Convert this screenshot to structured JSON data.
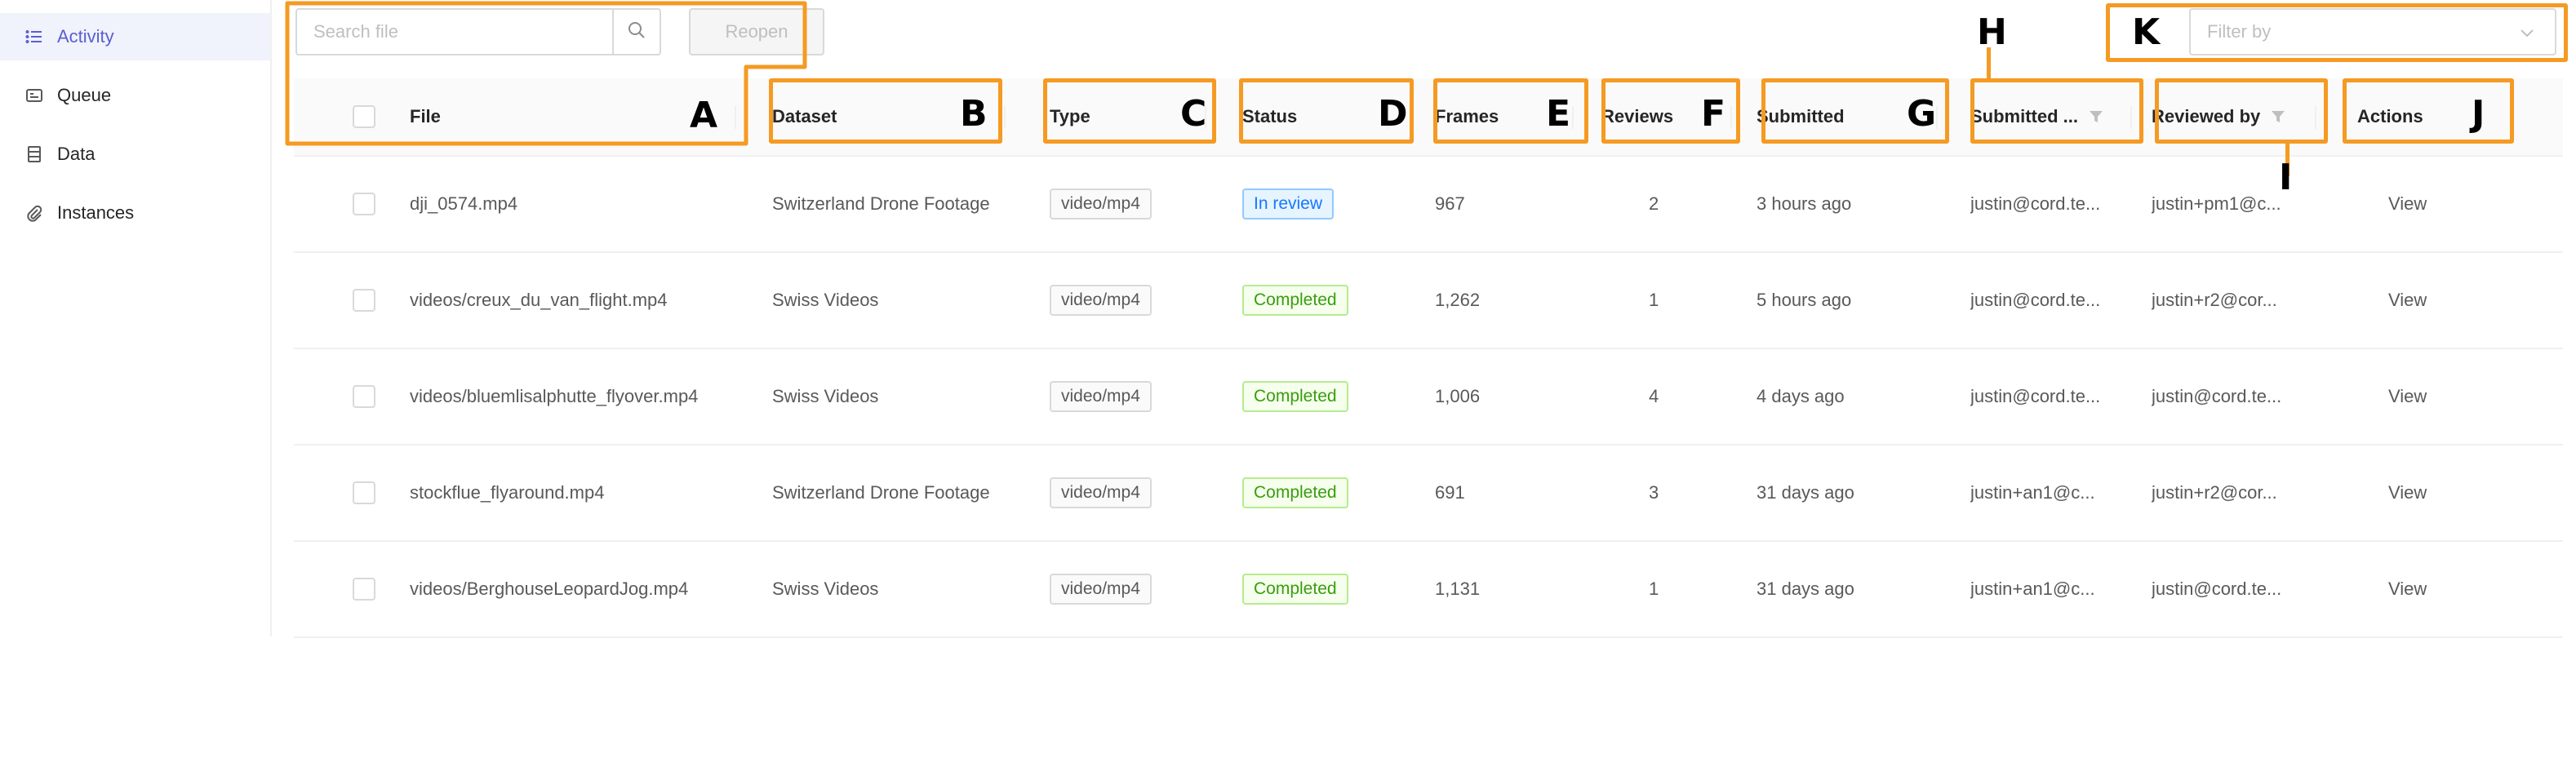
{
  "sidebar": {
    "items": [
      {
        "label": "Activity",
        "icon": "list-icon",
        "active": true
      },
      {
        "label": "Queue",
        "icon": "queue-icon",
        "active": false
      },
      {
        "label": "Data",
        "icon": "database-icon",
        "active": false
      },
      {
        "label": "Instances",
        "icon": "paperclip-icon",
        "active": false
      }
    ]
  },
  "toolbar": {
    "search_placeholder": "Search file",
    "reopen_label": "Reopen",
    "filter_placeholder": "Filter by"
  },
  "table": {
    "columns": [
      "File",
      "Dataset",
      "Type",
      "Status",
      "Frames",
      "Reviews",
      "Submitted",
      "Submitted ...",
      "Reviewed by",
      "Actions"
    ],
    "rows": [
      {
        "file": "dji_0574.mp4",
        "dataset": "Switzerland Drone Footage",
        "type": "video/mp4",
        "status": "In review",
        "frames": "967",
        "reviews": "2",
        "submitted": "3 hours ago",
        "submitted_by": "justin@cord.te...",
        "reviewed_by": "justin+pm1@c...",
        "action": "View"
      },
      {
        "file": "videos/creux_du_van_flight.mp4",
        "dataset": "Swiss Videos",
        "type": "video/mp4",
        "status": "Completed",
        "frames": "1,262",
        "reviews": "1",
        "submitted": "5 hours ago",
        "submitted_by": "justin@cord.te...",
        "reviewed_by": "justin+r2@cor...",
        "action": "View"
      },
      {
        "file": "videos/bluemlisalphutte_flyover.mp4",
        "dataset": "Swiss Videos",
        "type": "video/mp4",
        "status": "Completed",
        "frames": "1,006",
        "reviews": "4",
        "submitted": "4 days ago",
        "submitted_by": "justin@cord.te...",
        "reviewed_by": "justin@cord.te...",
        "action": "View"
      },
      {
        "file": "stockflue_flyaround.mp4",
        "dataset": "Switzerland Drone Footage",
        "type": "video/mp4",
        "status": "Completed",
        "frames": "691",
        "reviews": "3",
        "submitted": "31 days ago",
        "submitted_by": "justin+an1@c...",
        "reviewed_by": "justin+r2@cor...",
        "action": "View"
      },
      {
        "file": "videos/BerghouseLeopardJog.mp4",
        "dataset": "Swiss Videos",
        "type": "video/mp4",
        "status": "Completed",
        "frames": "1,131",
        "reviews": "1",
        "submitted": "31 days ago",
        "submitted_by": "justin+an1@c...",
        "reviewed_by": "justin@cord.te...",
        "action": "View"
      }
    ]
  },
  "annotations": [
    "A",
    "B",
    "C",
    "D",
    "E",
    "F",
    "G",
    "H",
    "I",
    "J",
    "K"
  ],
  "colors": {
    "accent": "#5a5fcf",
    "annotation": "#f59a23",
    "in_review": "#1677ff",
    "completed": "#389e0d"
  }
}
